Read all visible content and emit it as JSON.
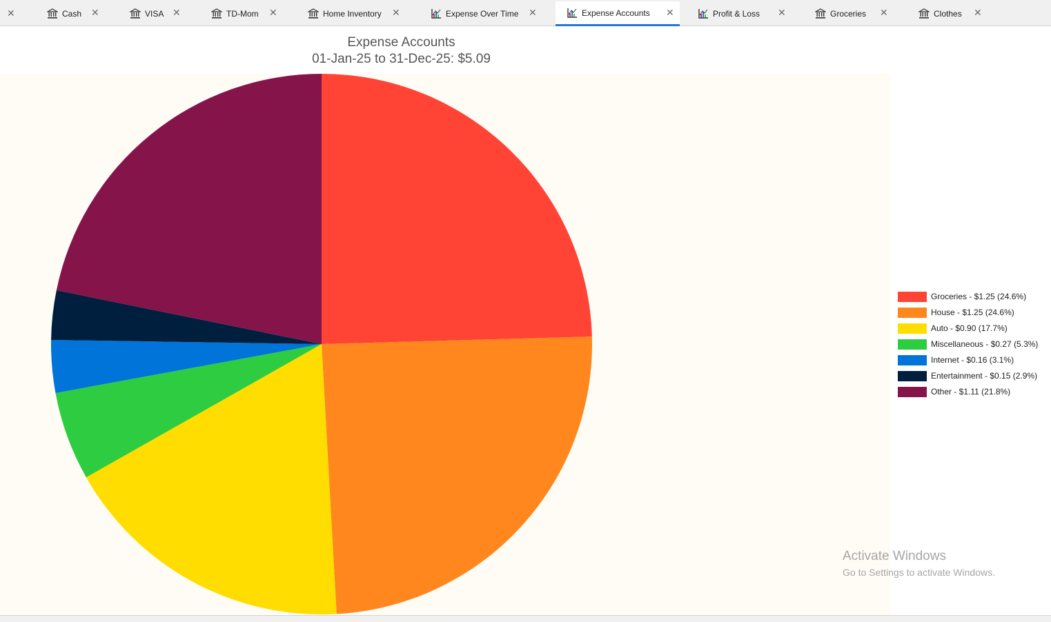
{
  "tabs": [
    {
      "label": "Cash",
      "icon": "bank-icon",
      "active": false
    },
    {
      "label": "VISA",
      "icon": "bank-icon",
      "active": false
    },
    {
      "label": "TD-Mom",
      "icon": "bank-icon",
      "active": false
    },
    {
      "label": "Home Inventory",
      "icon": "bank-icon",
      "active": false
    },
    {
      "label": "Expense Over Time",
      "icon": "chart-icon",
      "active": false
    },
    {
      "label": "Expense Accounts",
      "icon": "chart-icon",
      "active": true
    },
    {
      "label": "Profit & Loss",
      "icon": "chart-icon",
      "active": false
    },
    {
      "label": "Groceries",
      "icon": "bank-icon",
      "active": false
    },
    {
      "label": "Clothes",
      "icon": "bank-icon",
      "active": false
    }
  ],
  "close_glyph": "✕",
  "chart": {
    "title": "Expense Accounts",
    "subtitle": "01-Jan-25 to 31-Dec-25: $5.09"
  },
  "chart_data": {
    "type": "pie",
    "title": "Expense Accounts",
    "subtitle": "01-Jan-25 to 31-Dec-25: $5.09",
    "legend_position": "right",
    "slices": [
      {
        "name": "Groceries",
        "value": 1.25,
        "percent": 24.6,
        "color": "#ff4335",
        "legend": "Groceries - $1.25 (24.6%)"
      },
      {
        "name": "House",
        "value": 1.25,
        "percent": 24.6,
        "color": "#ff871e",
        "legend": "House - $1.25 (24.6%)"
      },
      {
        "name": "Auto",
        "value": 0.9,
        "percent": 17.7,
        "color": "#ffdd00",
        "legend": "Auto - $0.90 (17.7%)"
      },
      {
        "name": "Miscellaneous",
        "value": 0.27,
        "percent": 5.3,
        "color": "#2ecc40",
        "legend": "Miscellaneous - $0.27 (5.3%)"
      },
      {
        "name": "Internet",
        "value": 0.16,
        "percent": 3.1,
        "color": "#0074d9",
        "legend": "Internet - $0.16 (3.1%)"
      },
      {
        "name": "Entertainment",
        "value": 0.15,
        "percent": 2.9,
        "color": "#001f3f",
        "legend": "Entertainment - $0.15 (2.9%)"
      },
      {
        "name": "Other",
        "value": 1.11,
        "percent": 21.8,
        "color": "#85144b",
        "legend": "Other - $1.11 (21.8%)"
      }
    ]
  },
  "watermark": {
    "line1": "Activate Windows",
    "line2": "Go to Settings to activate Windows."
  }
}
